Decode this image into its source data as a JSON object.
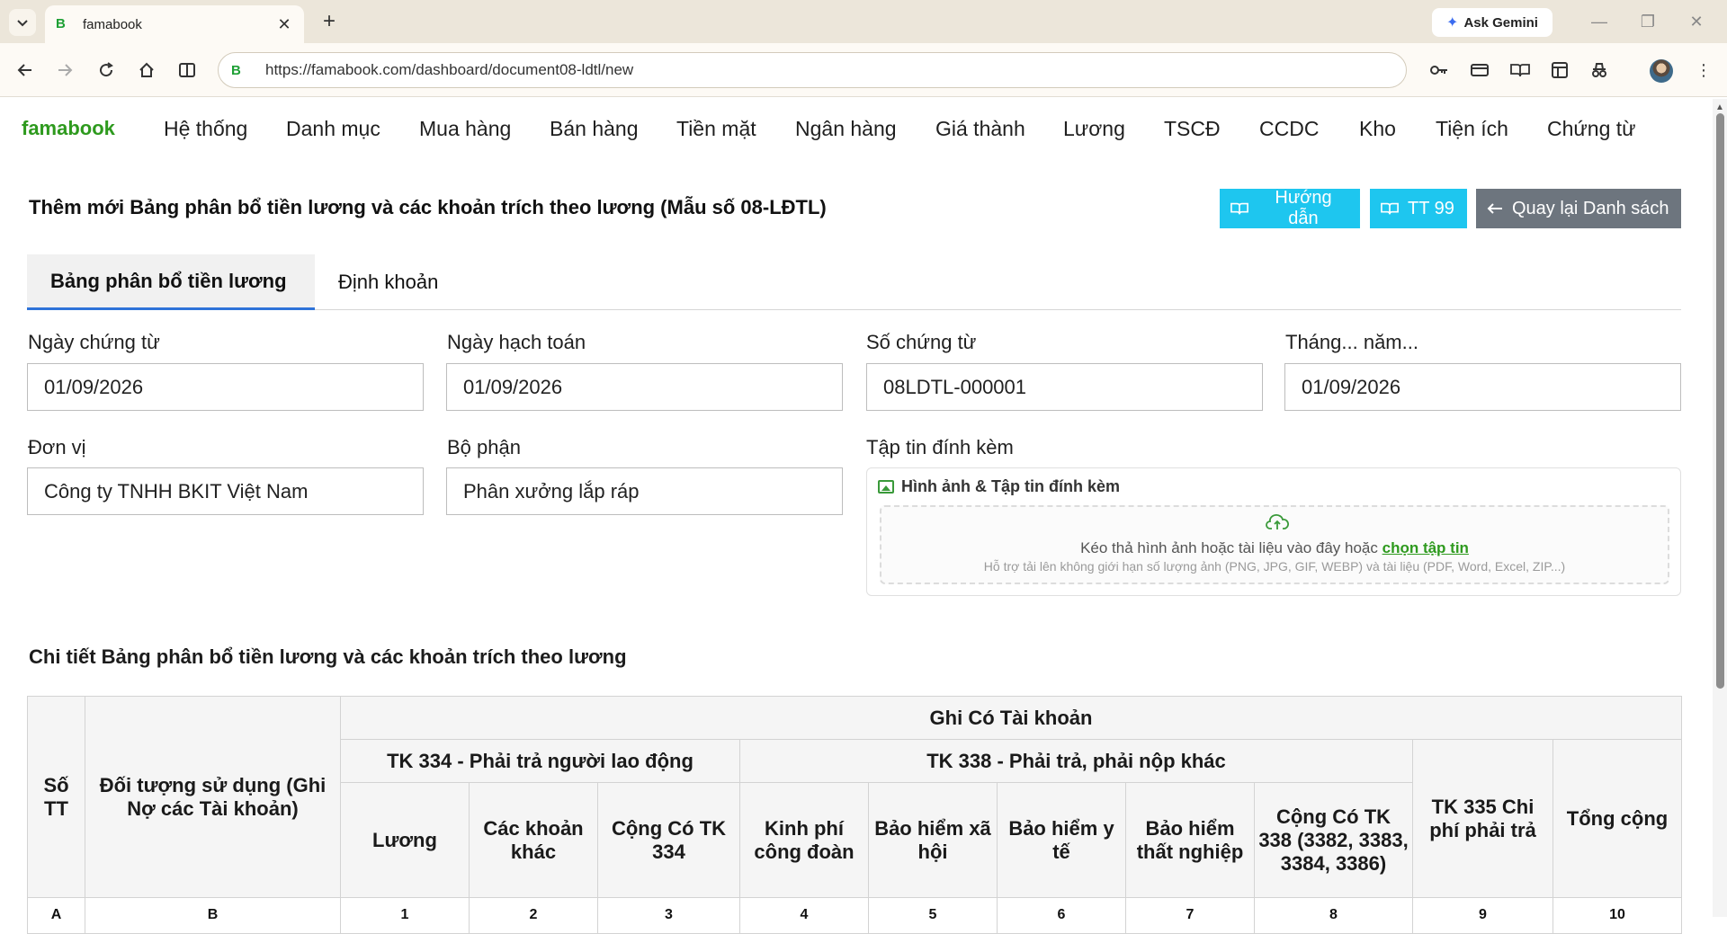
{
  "browser": {
    "tab_title": "famabook",
    "favicon_letter": "B",
    "url": "https://famabook.com/dashboard/document08-ldtl/new",
    "ask_gemini": "Ask Gemini"
  },
  "app": {
    "brand": "famabook",
    "menu": [
      "Hệ thống",
      "Danh mục",
      "Mua hàng",
      "Bán hàng",
      "Tiền mặt",
      "Ngân hàng",
      "Giá thành",
      "Lương",
      "TSCĐ",
      "CCDC",
      "Kho",
      "Tiện ích",
      "Chứng từ"
    ]
  },
  "page": {
    "title": "Thêm mới Bảng phân bổ tiền lương và các khoản trích theo lương (Mẫu số 08-LĐTL)",
    "buttons": {
      "guide": "Hướng dẫn",
      "tt99": "TT 99",
      "back": "Quay lại Danh sách"
    },
    "tabs": [
      "Bảng phân bổ tiền lương",
      "Định khoản"
    ]
  },
  "form": {
    "ngay_chung_tu": {
      "label": "Ngày chứng từ",
      "value": "01/09/2026"
    },
    "ngay_hach_toan": {
      "label": "Ngày hạch toán",
      "value": "01/09/2026"
    },
    "so_chung_tu": {
      "label": "Số chứng từ",
      "value": "08LDTL-000001"
    },
    "thang_nam": {
      "label": "Tháng... năm...",
      "value": "01/09/2026"
    },
    "don_vi": {
      "label": "Đơn vị",
      "value": "Công ty TNHH BKIT Việt Nam"
    },
    "bo_phan": {
      "label": "Bộ phận",
      "value": "Phân xưởng lắp ráp"
    },
    "attachments": {
      "label": "Tập tin đính kèm",
      "header": "Hình ảnh & Tập tin đính kèm",
      "drop_text": "Kéo thả hình ảnh hoặc tài liệu vào đây hoặc",
      "drop_link": "chọn tập tin",
      "drop_sub": "Hỗ trợ tải lên không giới hạn số lượng ảnh (PNG, JPG, GIF, WEBP) và tài liệu (PDF, Word, Excel, ZIP...)"
    }
  },
  "detail": {
    "title": "Chi tiết Bảng phân bổ tiền lương và các khoản trích theo lương",
    "headers": {
      "stt": "Số TT",
      "doi_tuong": "Đối tượng sử dụng (Ghi Nợ các Tài khoản)",
      "ghi_co": "Ghi Có Tài khoản",
      "tk334": "TK 334 - Phải trả người lao động",
      "tk338": "TK 338 - Phải trả, phải nộp khác",
      "tk335": "TK 335 Chi phí phải trả",
      "tong_cong": "Tổng cộng",
      "luong": "Lương",
      "cac_khoan_khac": "Các khoản khác",
      "cong_co_334": "Cộng Có TK 334",
      "kpcd": "Kinh phí công đoàn",
      "bhxh": "Bảo hiểm xã hội",
      "bhyt": "Bảo hiểm y tế",
      "bhtn": "Bảo hiểm thất nghiệp",
      "cong_co_338": "Cộng Có TK 338 (3382, 3383, 3384, 3386)"
    },
    "index_row": [
      "A",
      "B",
      "1",
      "2",
      "3",
      "4",
      "5",
      "6",
      "7",
      "8",
      "9",
      "10"
    ]
  }
}
